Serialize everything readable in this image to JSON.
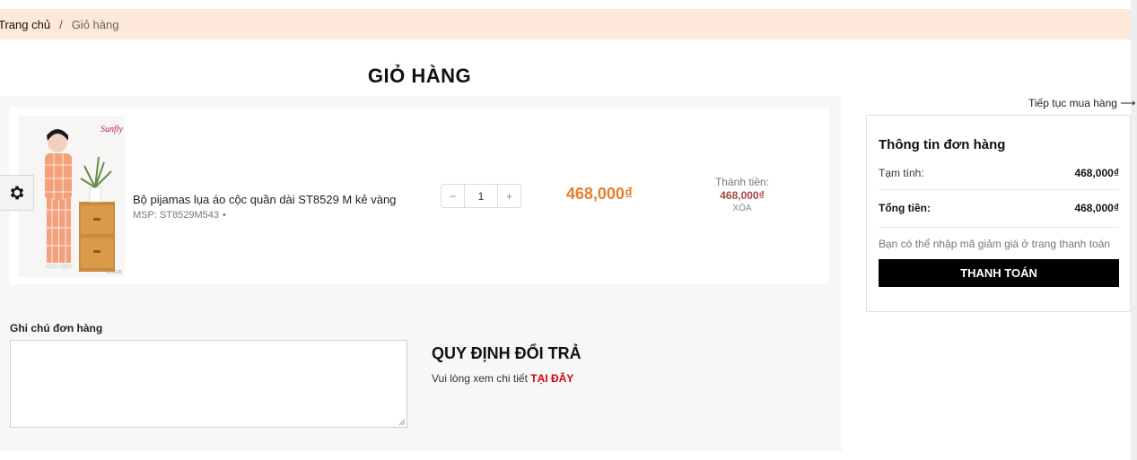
{
  "breadcrumb": {
    "home": "Trang chủ",
    "separator": "/",
    "current": "Giỏ hàng"
  },
  "page_title": "GIỎ HÀNG",
  "cart": {
    "items": [
      {
        "name": "Bộ pijamas lụa áo cộc quần dài ST8529 M kẻ vàng",
        "sku": "MSP: ST8529M543",
        "sku_dot": "•",
        "quantity": "1",
        "minus": "−",
        "plus": "+",
        "price": "468,000₫",
        "line_total_label": "Thành tiền:",
        "line_total": "468,000₫",
        "remove": "XÓA",
        "image_brand": "Sunfly",
        "image_code": "ST8529"
      }
    ]
  },
  "note": {
    "label": "Ghi chú đơn hàng",
    "value": ""
  },
  "policy": {
    "title": "QUY ĐỊNH ĐỔI TRẢ",
    "text": "Vui lòng xem chi tiết",
    "link": "TẠI ĐÂY"
  },
  "continue_shopping": "Tiếp tục mua hàng ⟶",
  "summary": {
    "title": "Thông tin đơn hàng",
    "subtotal_label": "Tạm tính:",
    "subtotal": "468,000₫",
    "total_label": "Tổng tiền:",
    "total": "468,000₫",
    "hint": "Bạn có thể nhập mã giảm giá ở trang thanh toán",
    "checkout": "THANH TOÁN"
  },
  "icons": {
    "settings": "gear-icon",
    "resize": "resize-grip-icon"
  },
  "colors": {
    "breadcrumb_bg": "#fde8da",
    "price": "#e57f2d",
    "line_total": "#a94442",
    "policy_link": "#d0021b",
    "checkout_bg": "#000000"
  }
}
